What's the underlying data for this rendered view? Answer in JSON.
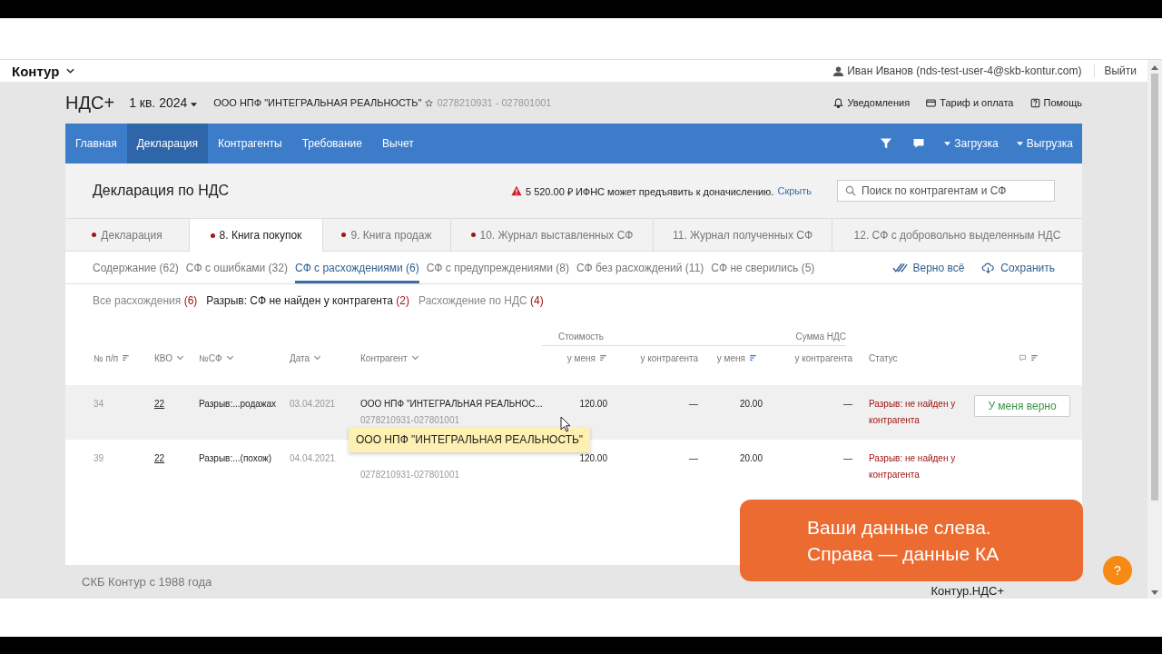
{
  "topbar": {
    "brand": "Контур",
    "user": "Иван Иванов (nds-test-user-4@skb-kontur.com)",
    "logout": "Выйти"
  },
  "header": {
    "product": "НДС+",
    "period": "1 кв. 2024",
    "org": "ООО НПФ \"ИНТЕГРАЛЬНАЯ РЕАЛЬНОСТЬ\"",
    "org_ids": "0278210931 - 027801001",
    "links": [
      {
        "kind": "bell",
        "label": "Уведомления"
      },
      {
        "kind": "card",
        "label": "Тариф и оплата"
      },
      {
        "kind": "help",
        "label": "Помощь"
      }
    ]
  },
  "nav": {
    "items": [
      {
        "label": "Главная",
        "selected": false
      },
      {
        "label": "Декларация",
        "selected": true
      },
      {
        "label": "Контрагенты",
        "selected": false
      },
      {
        "label": "Требование",
        "selected": false
      },
      {
        "label": "Вычет",
        "selected": false
      }
    ],
    "menus": [
      "Загрузка",
      "Выгрузка"
    ]
  },
  "page": {
    "title": "Декларация по НДС",
    "warning": "5 520.00 ₽ ИФНС может предъявить к доначислению.",
    "warning_link": "Скрыть",
    "search": {
      "placeholder": "Поиск по контрагентам и СФ"
    }
  },
  "tabs": [
    {
      "label": "Декларация",
      "dot": true,
      "selected": false
    },
    {
      "label": "8. Книга покупок",
      "dot": true,
      "selected": true
    },
    {
      "label": "9. Книга продаж",
      "dot": true,
      "selected": false
    },
    {
      "label": "10. Журнал выставленных СФ",
      "dot": true,
      "selected": false
    },
    {
      "label": "11. Журнал полученных СФ",
      "dot": false,
      "selected": false
    },
    {
      "label": "12. СФ с добровольно выделенным НДС",
      "dot": false,
      "selected": false
    }
  ],
  "subtabs": [
    {
      "label": "Содержание (62)",
      "selected": false
    },
    {
      "label": "СФ с ошибками (32)",
      "selected": false
    },
    {
      "label": "СФ с расхождениями (6)",
      "selected": true
    },
    {
      "label": "СФ с предупреждениями (8)",
      "selected": false
    },
    {
      "label": "СФ без расхождений (11)",
      "selected": false
    },
    {
      "label": "СФ не сверились (5)",
      "selected": false
    }
  ],
  "actions": [
    {
      "kind": "check",
      "label": "Верно всё"
    },
    {
      "kind": "cloud",
      "label": "Сохранить"
    }
  ],
  "filters": [
    {
      "label": "Все расхождения",
      "count": "(6)",
      "selected": false
    },
    {
      "label": "Разрыв: СФ не найден у контрагента",
      "count": "(2)",
      "selected": true
    },
    {
      "label": "Расхождение по НДС",
      "count": "(4)",
      "selected": false
    }
  ],
  "table": {
    "groups": [
      "Стоимость",
      "Сумма НДС"
    ],
    "columns": [
      {
        "label": "№ п/п",
        "kind": "sort"
      },
      {
        "label": "КВО",
        "kind": "dropdown"
      },
      {
        "label": "№СФ",
        "kind": "dropdown"
      },
      {
        "label": "Дата",
        "kind": "dropdown"
      },
      {
        "label": "Контрагент",
        "kind": "dropdown"
      },
      {
        "label": "у меня",
        "kind": "sort"
      },
      {
        "label": "у контрагента",
        "kind": "none"
      },
      {
        "label": "у меня",
        "kind": "sort-active"
      },
      {
        "label": "у контрагента",
        "kind": "none"
      },
      {
        "label": "Статус",
        "kind": "none"
      },
      {
        "kind": "comment"
      }
    ],
    "rows": [
      {
        "selected": true,
        "num": "34",
        "kvo": "22",
        "sf": "Разрыв:...родажах",
        "date": "03.04.2021",
        "name": "ООО НПФ \"ИНТЕГРАЛЬНАЯ РЕАЛЬНОС...",
        "ids": "0278210931-027801001",
        "cost_me": "120.00",
        "cost_ka": "—",
        "vat_me": "20.00",
        "vat_ka": "—",
        "status": "Разрыв: не найден у контрагента",
        "action": "У меня верно"
      },
      {
        "selected": false,
        "num": "39",
        "kvo": "22",
        "sf": "Разрыв:...(похож)",
        "date": "04.04.2021",
        "ids": "0278210931-027801001",
        "cost_me": "120.00",
        "cost_ka": "—",
        "vat_me": "20.00",
        "vat_ka": "—",
        "status": "Разрыв: не найден у контрагента"
      }
    ]
  },
  "tooltip": "ООО НПФ \"ИНТЕГРАЛЬНАЯ РЕАЛЬНОСТЬ\"",
  "footer": {
    "copyright": "СКБ Контур с 1988 года",
    "product": "Контур.НДС+"
  },
  "caption": {
    "lines": [
      "Ваши данные слева.",
      "Справа — данные КА"
    ]
  },
  "help_button": "?"
}
